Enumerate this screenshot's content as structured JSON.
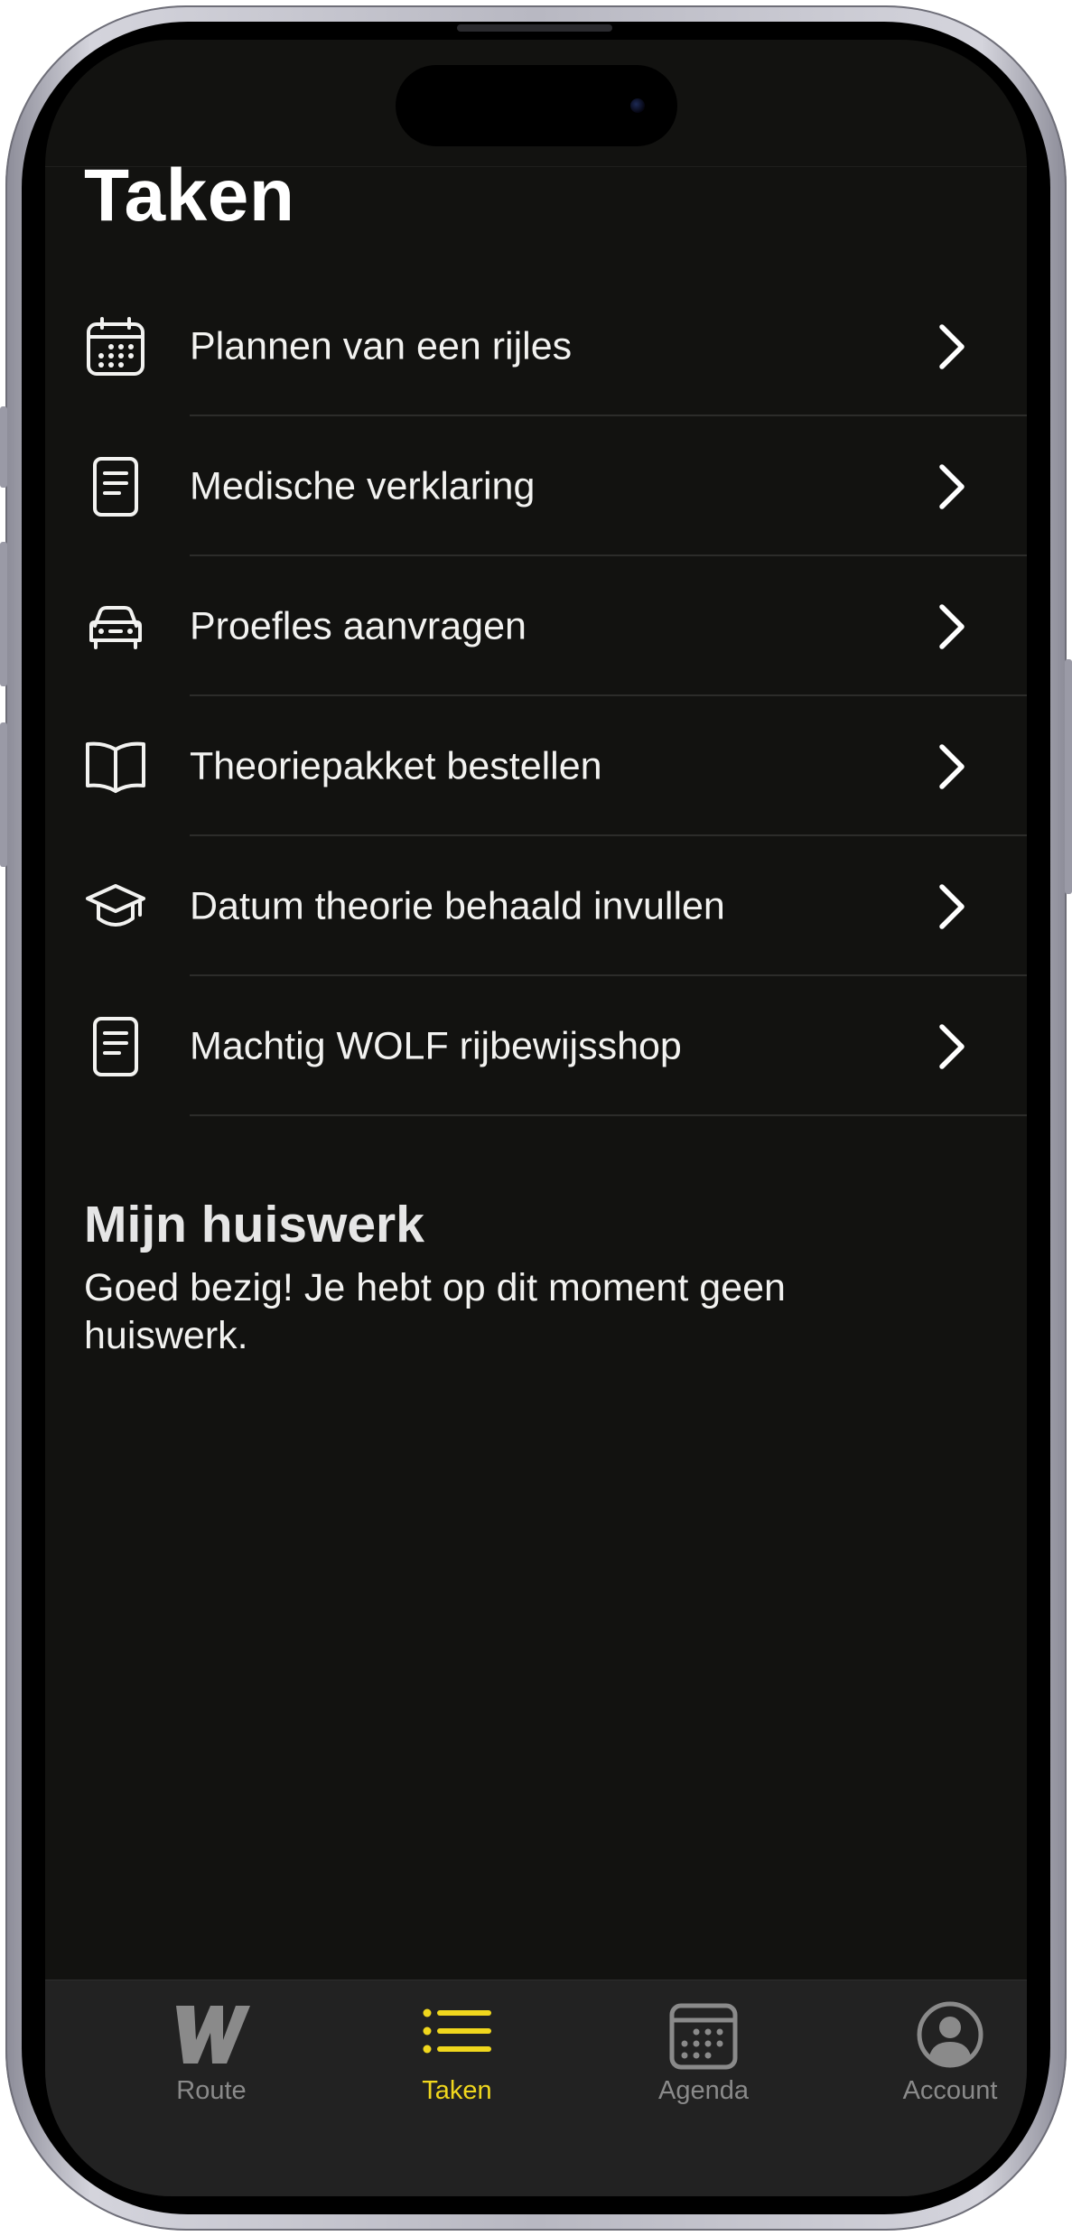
{
  "page": {
    "title": "Taken"
  },
  "tasks": [
    {
      "label": "Plannen van een rijles",
      "icon": "calendar-icon"
    },
    {
      "label": "Medische verklaring",
      "icon": "document-icon"
    },
    {
      "label": "Proefles aanvragen",
      "icon": "car-icon"
    },
    {
      "label": "Theoriepakket bestellen",
      "icon": "book-icon"
    },
    {
      "label": "Datum theorie behaald invullen",
      "icon": "graduation-cap-icon"
    },
    {
      "label": "Machtig WOLF rijbewijsshop",
      "icon": "document-icon"
    }
  ],
  "homework": {
    "title": "Mijn huiswerk",
    "text": "Goed bezig! Je hebt op dit moment geen huiswerk."
  },
  "tabbar": {
    "tabs": [
      {
        "label": "Route",
        "icon": "wolf-logo-icon",
        "active": false
      },
      {
        "label": "Taken",
        "icon": "list-icon",
        "active": true
      },
      {
        "label": "Agenda",
        "icon": "calendar-icon",
        "active": false
      },
      {
        "label": "Account",
        "icon": "account-icon",
        "active": false
      }
    ]
  },
  "colors": {
    "background": "#121210",
    "accent": "#f0d71d",
    "tabbar": "#222222",
    "inactive": "#8a8a8a",
    "text": "#f2f2f0"
  }
}
